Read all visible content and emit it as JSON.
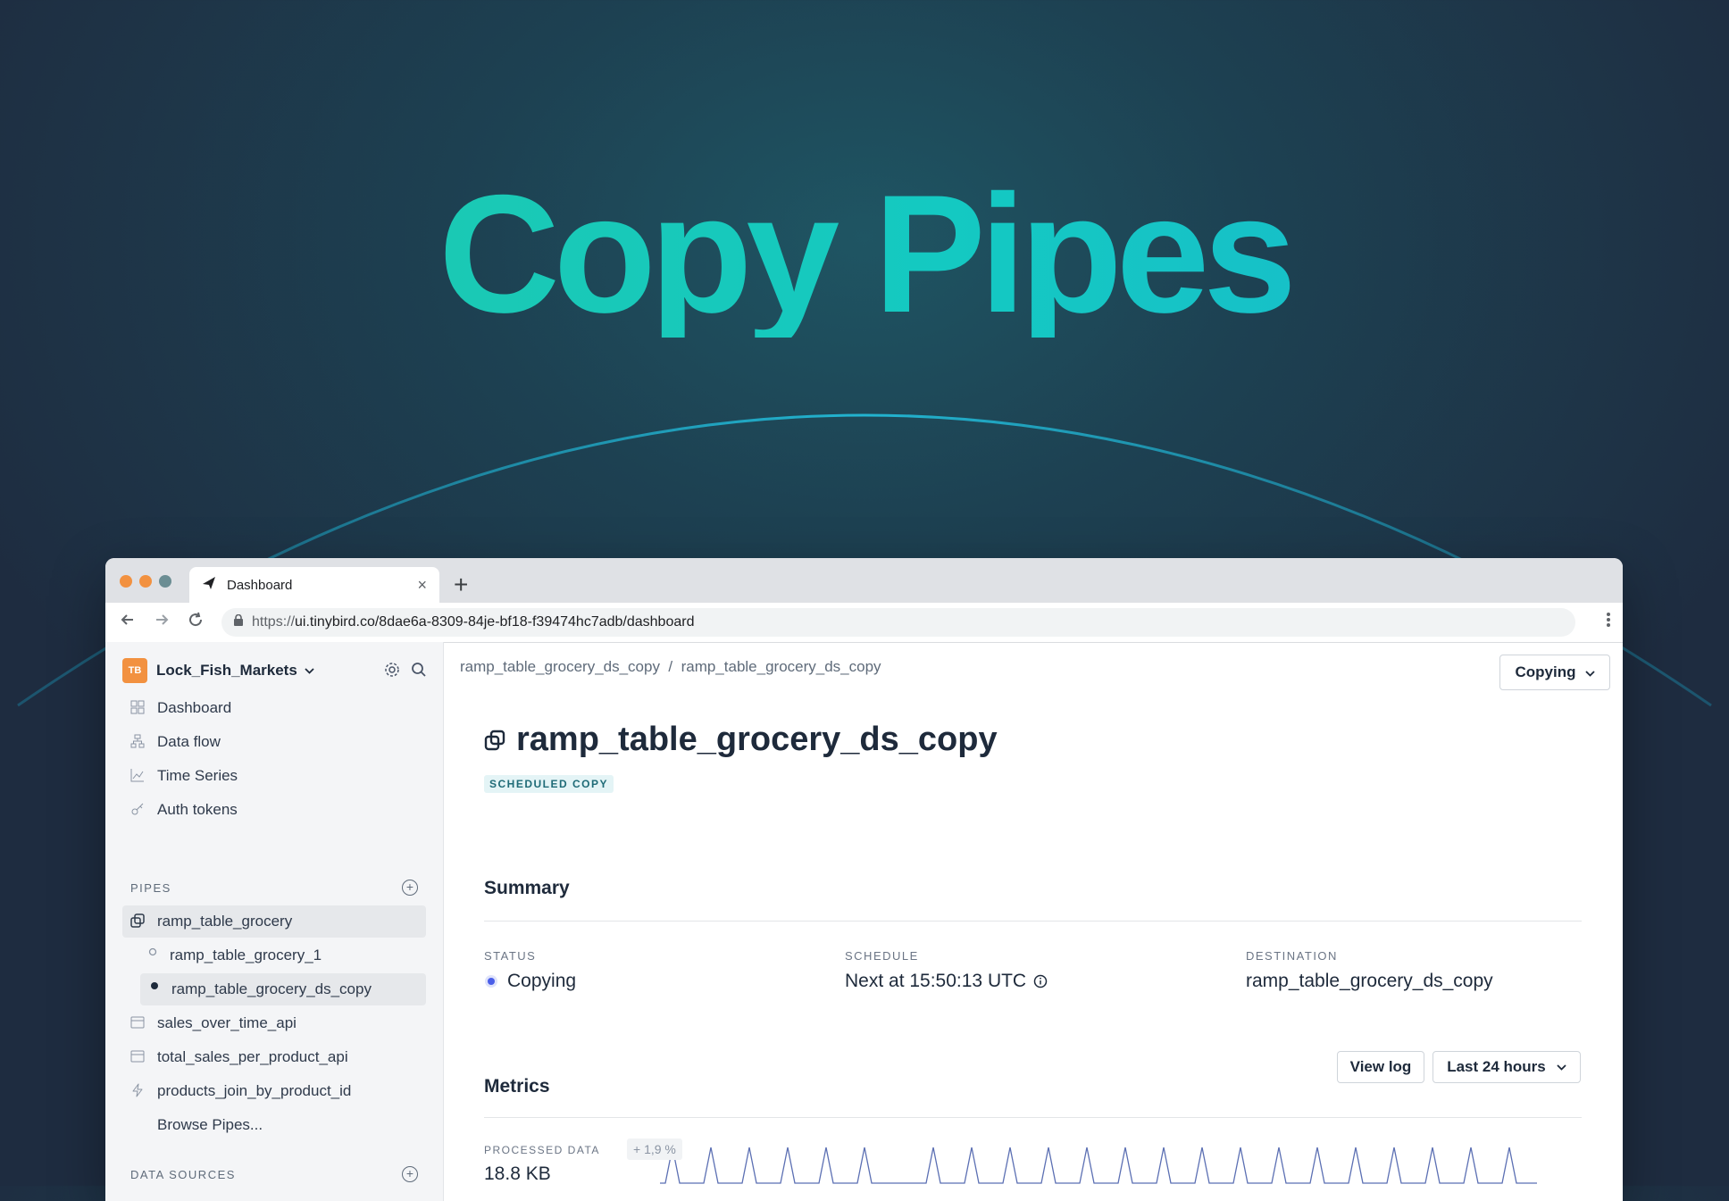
{
  "hero": {
    "title": "Copy Pipes"
  },
  "browser": {
    "tab": {
      "label": "Dashboard",
      "close": "×"
    },
    "new_tab": "+",
    "url_scheme": "https://",
    "url_rest": "ui.tinybird.co/8dae6a-8309-84je-bf18-f39474hc7adb/dashboard",
    "traffic_colors": [
      "#f29140",
      "#f29140",
      "#6b8d93"
    ]
  },
  "sidebar": {
    "workspace": {
      "badge": "TB",
      "name": "Lock_Fish_Markets"
    },
    "nav": [
      {
        "label": "Dashboard",
        "icon": "grid-icon"
      },
      {
        "label": "Data flow",
        "icon": "data-flow-icon"
      },
      {
        "label": "Time Series",
        "icon": "chart-line-icon"
      },
      {
        "label": "Auth tokens",
        "icon": "key-icon"
      }
    ],
    "pipes_label": "PIPES",
    "pipes": [
      {
        "label": "ramp_table_grocery"
      },
      {
        "label": "ramp_table_grocery_1"
      },
      {
        "label": "ramp_table_grocery_ds_copy"
      },
      {
        "label": "sales_over_time_api"
      },
      {
        "label": "total_sales_per_product_api"
      },
      {
        "label": "products_join_by_product_id"
      },
      {
        "label": "Browse Pipes..."
      }
    ],
    "datasources_label": "DATA SOURCES"
  },
  "main": {
    "breadcrumb": "ramp_table_grocery_ds_copy  /  ramp_table_grocery_ds_copy",
    "copying_button": "Copying",
    "title": "ramp_table_grocery_ds_copy",
    "tag": "SCHEDULED COPY",
    "summary": {
      "heading": "Summary",
      "status_label": "STATUS",
      "status_value": "Copying",
      "schedule_label": "SCHEDULE",
      "schedule_value": "Next at 15:50:13 UTC",
      "destination_label": "DESTINATION",
      "destination_value": "ramp_table_grocery_ds_copy"
    },
    "metrics": {
      "heading": "Metrics",
      "view_log": "View log",
      "range": "Last 24 hours",
      "processed_label": "PROCESSED DATA",
      "processed_value": "18.8 KB",
      "change": "+ 1,9 %"
    }
  },
  "colors": {
    "accent": "#14c9c2",
    "status_dot": "#4a5ee8",
    "sparkline": "#5b6fb3"
  }
}
